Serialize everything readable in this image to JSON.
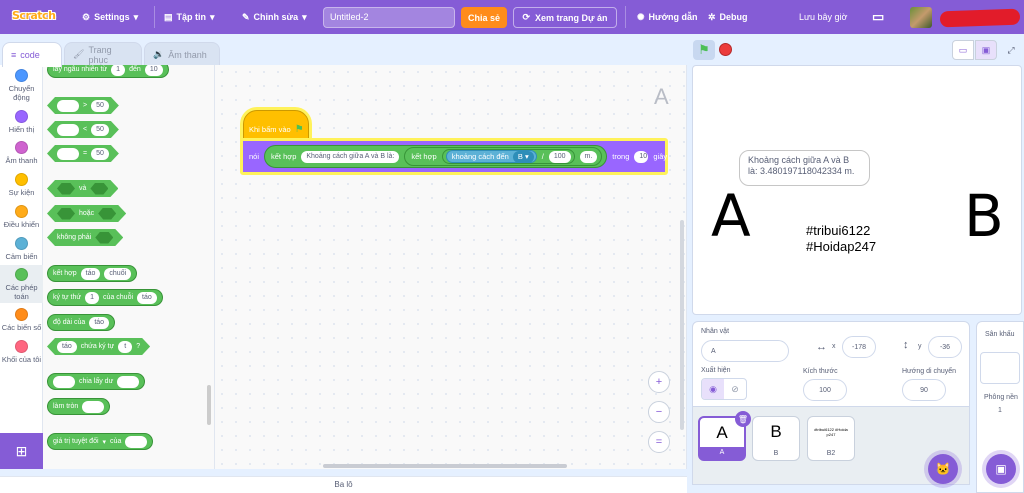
{
  "menubar": {
    "logo": "Scratch",
    "settings": "Settings",
    "file": "Tập tin",
    "edit": "Chỉnh sửa",
    "project_title": "Untitled-2",
    "share": "Chia sẻ",
    "see_project": "Xem trang Dự án",
    "tutorials": "Hướng dẫn",
    "debug": "Debug",
    "save_now": "Lưu bây giờ"
  },
  "tabs": {
    "code": "code",
    "costumes": "Trang phục",
    "sounds": "Âm thanh"
  },
  "categories": [
    {
      "label": "Chuyển động",
      "color": "#4c97ff"
    },
    {
      "label": "Hiển thị",
      "color": "#9966ff"
    },
    {
      "label": "Âm thanh",
      "color": "#cf63cf"
    },
    {
      "label": "Sự kiện",
      "color": "#ffbf00"
    },
    {
      "label": "Điều khiển",
      "color": "#ffab19"
    },
    {
      "label": "Cảm biến",
      "color": "#5cb1d6"
    },
    {
      "label": "Các phép toán",
      "color": "#59c059"
    },
    {
      "label": "Các biến số",
      "color": "#ff8c1a"
    },
    {
      "label": "Khối của tôi",
      "color": "#ff6680"
    }
  ],
  "palette": {
    "random_pre": "lấy ngẫu nhiên từ",
    "random_from": "1",
    "random_mid": "đến",
    "random_to": "10",
    "gt": ">",
    "lt": "<",
    "eq": "=",
    "cmp_value": "50",
    "and": "và",
    "or": "hoặc",
    "not": "không phải",
    "join": "kết hợp",
    "join_a": "táo",
    "join_b": "chuối",
    "letter_pre": "ký tự thứ",
    "letter_n": "1",
    "letter_mid": "của chuỗi",
    "letter_s": "táo",
    "length_pre": "độ dài của",
    "length_s": "táo",
    "contains_s": "táo",
    "contains_mid": "chứa ký tự",
    "contains_c": "t",
    "contains_q": "?",
    "mod": "chia lấy dư",
    "round": "làm tròn",
    "abs": "giá trị tuyệt đối",
    "abs_of": "của"
  },
  "script": {
    "sprite_letter": "A",
    "hat_label": "Khi bấm vào",
    "say": "nói",
    "join1": "kết hợp",
    "text": "Khoảng cách giữa A và B là:",
    "join2": "kết hợp",
    "distance": "khoảng cách đến",
    "target": "B",
    "divide": "/",
    "divisor": "100",
    "unit": "m.",
    "for": "trong",
    "secs": "10",
    "secs_label": "giây"
  },
  "zoom": {
    "in": "+",
    "out": "−",
    "reset": "="
  },
  "backpack": "Ba lô",
  "stage": {
    "bubble": "Khoảng cách giữa A và B là: 3.480197118042334 m.",
    "bubble_l1": "Khoảng cách giữa A và B",
    "bubble_l2": "là: 3.480197118042334 m.",
    "letter_a": "A",
    "letter_b": "B",
    "tag1": "#tribui6122",
    "tag2": "#Hoidap247"
  },
  "sprite_info": {
    "sprite_label": "Nhân vật",
    "sprite_name": "A",
    "x_label": "x",
    "x": "-178",
    "y_label": "y",
    "y": "-36",
    "show_label": "Xuất hiện",
    "size_label": "Kích thước",
    "size": "100",
    "direction_label": "Hướng di chuyển",
    "direction": "90"
  },
  "sprites": [
    {
      "glyph": "A",
      "name": "A"
    },
    {
      "glyph": "B",
      "name": "B"
    },
    {
      "glyph": "#tribui6122 #Hoidap247",
      "name": "B2"
    }
  ],
  "stage_panel": {
    "title": "Sân khấu",
    "backdrops_label": "Phông nền",
    "backdrops_count": "1"
  },
  "colors": {
    "accent": "#855cd6",
    "operators": "#59c059",
    "looks": "#9966ff",
    "events": "#ffbf00",
    "sensing": "#5cb1d6",
    "share": "#ff8c1a"
  }
}
